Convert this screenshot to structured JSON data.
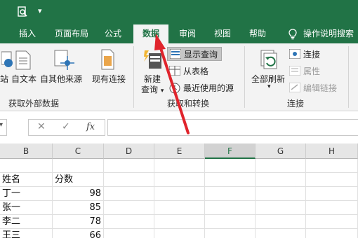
{
  "ribbon_tabs": [
    "插入",
    "页面布局",
    "公式",
    "数据",
    "审阅",
    "视图",
    "帮助"
  ],
  "active_tab": "数据",
  "tell_me": "操作说明搜索",
  "get_external": {
    "site_partial": "站",
    "from_text": "自文本",
    "from_other": "自其他来源",
    "existing": "现有连接",
    "group_label": "获取外部数据"
  },
  "get_transform": {
    "new_query_line1": "新建",
    "new_query_line2": "查询",
    "show_queries": "显示查询",
    "from_table": "从表格",
    "recent_sources": "最近使用的源",
    "group_label": "获取和转换"
  },
  "connections": {
    "refresh_all_line1": "全部刷新",
    "connections": "连接",
    "properties": "属性",
    "edit_links": "编辑链接",
    "group_label": "连接"
  },
  "formula_bar": {
    "cancel": "✕",
    "enter": "✓",
    "fx": "fx",
    "value": ""
  },
  "columns": [
    "B",
    "C",
    "D",
    "E",
    "F",
    "G",
    "H"
  ],
  "selected_column": "F",
  "table": {
    "header_name": "姓名",
    "header_score": "分数",
    "rows": [
      {
        "name": "丁一",
        "score": "98"
      },
      {
        "name": "张一",
        "score": "85"
      },
      {
        "name": "李二",
        "score": "78"
      },
      {
        "name": "王三",
        "score": "66"
      }
    ]
  },
  "colors": {
    "excel_green": "#217346",
    "arrow_red": "#e0242c"
  }
}
